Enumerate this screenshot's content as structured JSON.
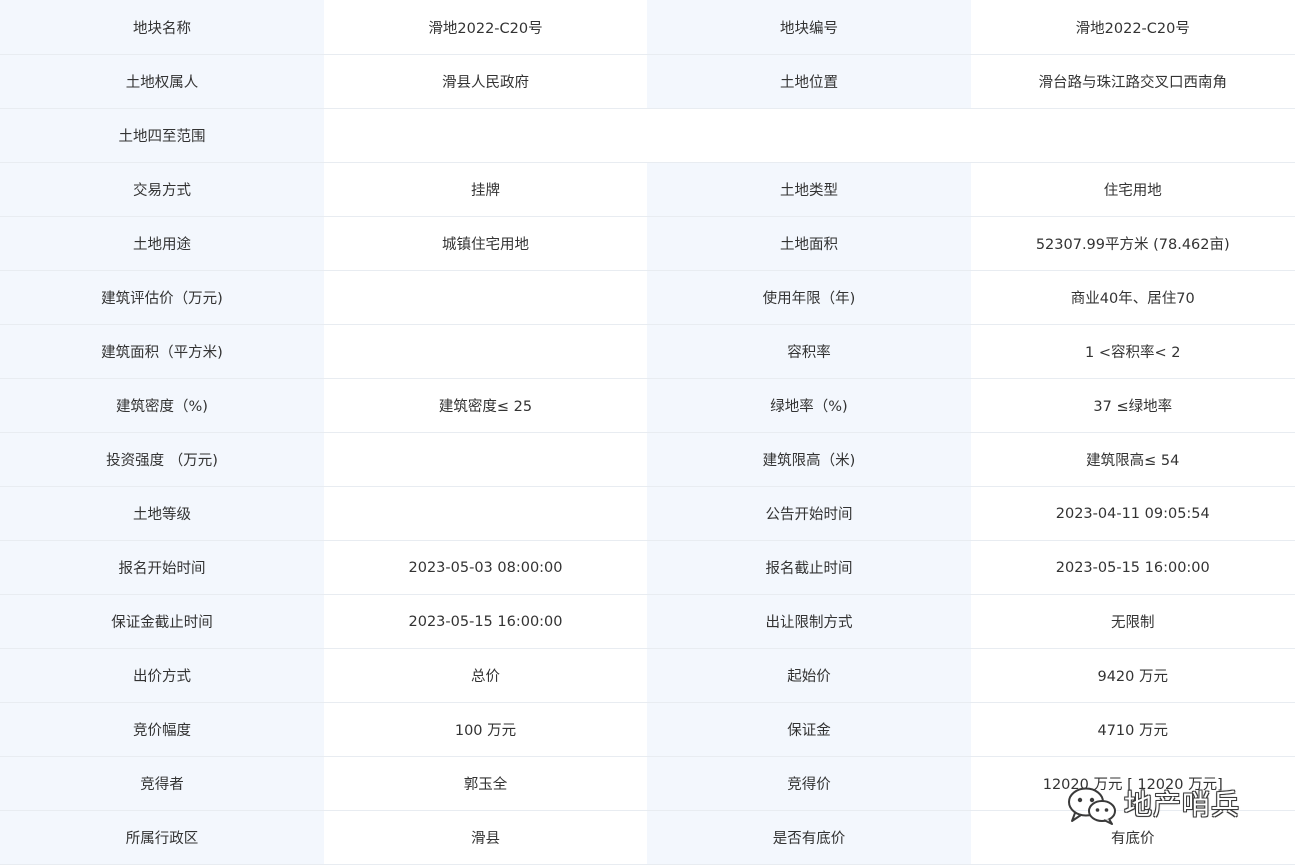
{
  "rows": [
    [
      {
        "label": "地块名称",
        "value": "滑地2022-C20号"
      },
      {
        "label": "地块编号",
        "value": "滑地2022-C20号"
      }
    ],
    [
      {
        "label": "土地权属人",
        "value": "滑县人民政府"
      },
      {
        "label": "土地位置",
        "value": "滑台路与珠江路交叉口西南角"
      }
    ],
    [
      {
        "label": "土地四至范围",
        "value": ""
      }
    ],
    [
      {
        "label": "交易方式",
        "value": "挂牌"
      },
      {
        "label": "土地类型",
        "value": "住宅用地"
      }
    ],
    [
      {
        "label": "土地用途",
        "value": "城镇住宅用地"
      },
      {
        "label": "土地面积",
        "value": "52307.99平方米 (78.462亩)"
      }
    ],
    [
      {
        "label": "建筑评估价（万元)",
        "value": ""
      },
      {
        "label": "使用年限（年)",
        "value": "商业40年、居住70"
      }
    ],
    [
      {
        "label": "建筑面积（平方米)",
        "value": ""
      },
      {
        "label": "容积率",
        "value": "1 <容积率< 2"
      }
    ],
    [
      {
        "label": "建筑密度（%)",
        "value": "建筑密度≤ 25"
      },
      {
        "label": "绿地率（%)",
        "value": "37 ≤绿地率"
      }
    ],
    [
      {
        "label": "投资强度 （万元)",
        "value": ""
      },
      {
        "label": "建筑限高（米)",
        "value": "建筑限高≤ 54"
      }
    ],
    [
      {
        "label": "土地等级",
        "value": ""
      },
      {
        "label": "公告开始时间",
        "value": "2023-04-11 09:05:54"
      }
    ],
    [
      {
        "label": "报名开始时间",
        "value": "2023-05-03 08:00:00"
      },
      {
        "label": "报名截止时间",
        "value": "2023-05-15 16:00:00"
      }
    ],
    [
      {
        "label": "保证金截止时间",
        "value": "2023-05-15 16:00:00"
      },
      {
        "label": "出让限制方式",
        "value": "无限制"
      }
    ],
    [
      {
        "label": "出价方式",
        "value": "总价"
      },
      {
        "label": "起始价",
        "value": "9420 万元"
      }
    ],
    [
      {
        "label": "竞价幅度",
        "value": "100 万元"
      },
      {
        "label": "保证金",
        "value": "4710 万元"
      }
    ],
    [
      {
        "label": "竞得者",
        "value": "郭玉全"
      },
      {
        "label": "竞得价",
        "value": "12020 万元 [ 12020 万元]"
      }
    ],
    [
      {
        "label": "所属行政区",
        "value": "滑县"
      },
      {
        "label": "是否有底价",
        "value": "有底价"
      }
    ]
  ],
  "watermark": {
    "icon": "wechat-icon",
    "text": "地产哨兵"
  },
  "colors": {
    "label_bg": "#f3f7fd",
    "value_bg": "#ffffff",
    "border": "#e8ecf1",
    "text": "#333333"
  }
}
